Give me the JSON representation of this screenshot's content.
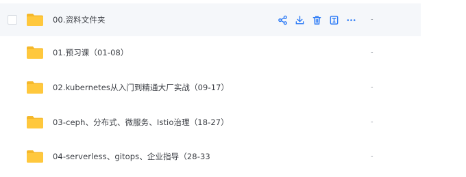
{
  "colors": {
    "accent": "#2f7cf6",
    "folder_back": "#f5b82a",
    "folder_front": "#ffc83d",
    "hover_row": "#f5f7fa"
  },
  "files": [
    {
      "name": "00.资料文件夹",
      "date": "-",
      "selected": false
    },
    {
      "name": "01.预习课（01-08）",
      "date": "-"
    },
    {
      "name": "02.kubernetes从入门到精通大厂实战（09-17）",
      "date": "-"
    },
    {
      "name": "03-ceph、分布式、微服务、Istio治理（18-27）",
      "date": "-"
    },
    {
      "name": "04-serverless、gitops、企业指导（28-33",
      "date": "-"
    }
  ],
  "row_actions": [
    "share-icon",
    "download-icon",
    "delete-icon",
    "rename-icon",
    "more-icon"
  ]
}
